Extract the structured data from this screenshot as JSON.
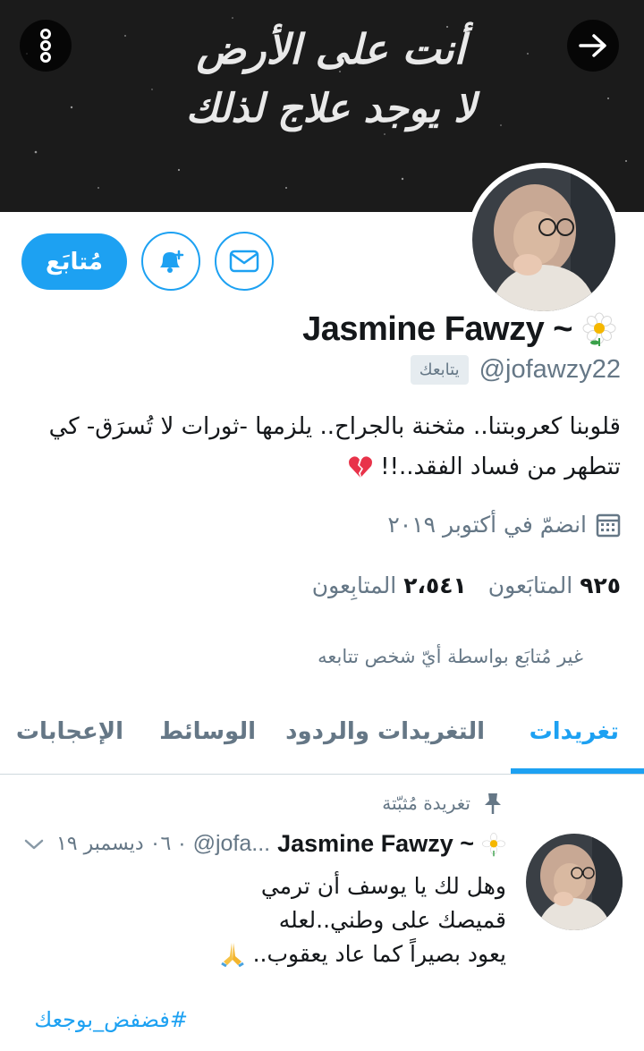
{
  "banner": {
    "line1": "أنت على الأرض",
    "line2": "لا يوجد علاج لذلك"
  },
  "profile": {
    "display_name": "Jasmine Fawzy ~",
    "handle": "@jofawzy22",
    "follows_you": "يتابعك",
    "bio_line1": "قلوبنا كعروبتنا.. مثخنة بالجراح..  يلزمها -ثورات لا تُسرَق- كي",
    "bio_line2": "تتطهر من فساد الفقد..!!",
    "joined": "انضمّ في أكتوبر ٢٠١٩",
    "following_count": "٩٢٥",
    "following_label": "المتابَعون",
    "followers_count": "٢،٥٤١",
    "followers_label": "المتابِعون",
    "followed_by_note": "غير مُتابَع بواسطة أيّ شخص تتابعه"
  },
  "actions": {
    "follow_label": "مُتابَع"
  },
  "tabs": [
    {
      "label": "تغريدات",
      "active": true
    },
    {
      "label": "التغريدات والردود",
      "active": false
    },
    {
      "label": "الوسائط",
      "active": false
    },
    {
      "label": "الإعجابات",
      "active": false
    }
  ],
  "pinned_tweet": {
    "pinned_label": "تغريدة مُثبّتة",
    "author_name": "Jasmine Fawzy ~",
    "author_handle": "@jofa...",
    "separator": "·",
    "date": "٠٦ ديسمبر ١٩",
    "line1": "وهل لك يا يوسف أن ترمي",
    "line2": "قميصك على وطني..لعله",
    "line3": "يعود بصيراً كما عاد يعقوب..",
    "hashtag": "#فضفض_بوجعك"
  },
  "colors": {
    "accent": "#1da1f2",
    "muted": "#657786",
    "text": "#14171a",
    "broken_heart": "#e8334a"
  },
  "icons": [
    "more-vertical-icon",
    "arrow-right-icon",
    "bell-plus-icon",
    "envelope-icon",
    "calendar-icon",
    "pin-icon",
    "chevron-down-icon",
    "flower-icon",
    "broken-heart-icon",
    "pray-hands-icon"
  ]
}
